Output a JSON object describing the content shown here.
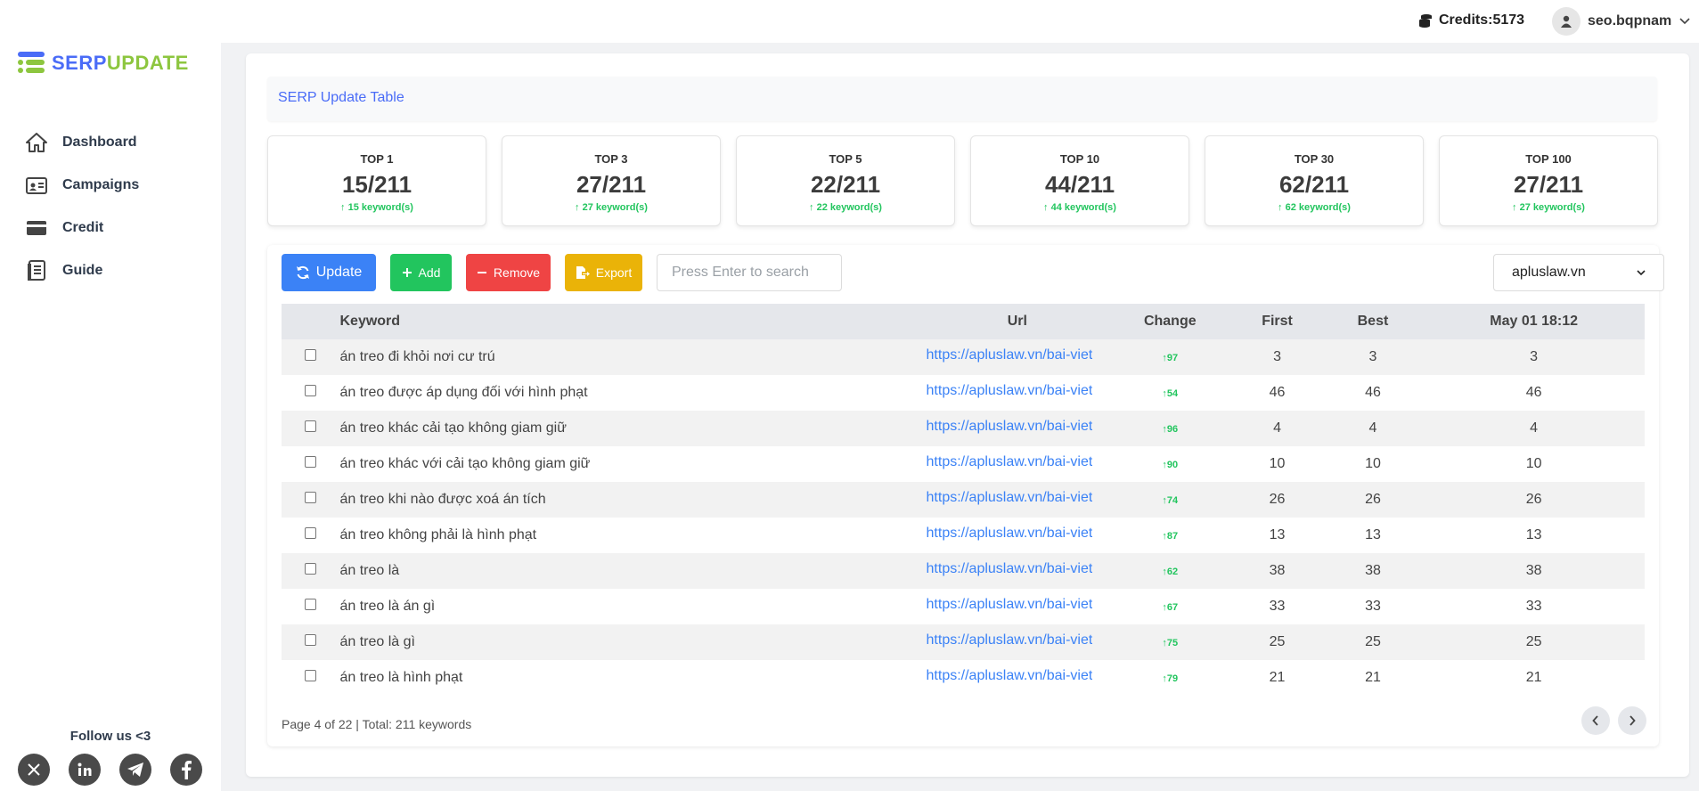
{
  "brand": {
    "part1": "SERP",
    "part2": "UPDATE"
  },
  "sidebar": {
    "items": [
      {
        "label": "Dashboard",
        "icon": "home-icon"
      },
      {
        "label": "Campaigns",
        "icon": "id-card-icon"
      },
      {
        "label": "Credit",
        "icon": "credit-card-icon"
      },
      {
        "label": "Guide",
        "icon": "book-icon"
      }
    ],
    "follow": "Follow us <3",
    "socials": [
      "x-icon",
      "linkedin-icon",
      "telegram-icon",
      "facebook-icon"
    ]
  },
  "topbar": {
    "credits": "Credits:5173",
    "username": "seo.bqpnam"
  },
  "table_title": "SERP Update Table",
  "stats": [
    {
      "title": "TOP 1",
      "value": "15/211",
      "change": "↑ 15 keyword(s)"
    },
    {
      "title": "TOP 3",
      "value": "27/211",
      "change": "↑ 27 keyword(s)"
    },
    {
      "title": "TOP 5",
      "value": "22/211",
      "change": "↑ 22 keyword(s)"
    },
    {
      "title": "TOP 10",
      "value": "44/211",
      "change": "↑ 44 keyword(s)"
    },
    {
      "title": "TOP 30",
      "value": "62/211",
      "change": "↑ 62 keyword(s)"
    },
    {
      "title": "TOP 100",
      "value": "27/211",
      "change": "↑ 27 keyword(s)"
    }
  ],
  "toolbar": {
    "update": "Update",
    "add": "Add",
    "remove": "Remove",
    "export": "Export",
    "search_placeholder": "Press Enter to search",
    "domain": "apluslaw.vn"
  },
  "columns": [
    "Keyword",
    "Url",
    "Change",
    "First",
    "Best",
    "May 01 18:12"
  ],
  "rows": [
    {
      "keyword": "án treo đi khỏi nơi cư trú",
      "url": "https://apluslaw.vn/bai-viet",
      "change": "↑97",
      "first": "3",
      "best": "3",
      "latest": "3"
    },
    {
      "keyword": "án treo được áp dụng đối với hình phạt",
      "url": "https://apluslaw.vn/bai-viet",
      "change": "↑54",
      "first": "46",
      "best": "46",
      "latest": "46"
    },
    {
      "keyword": "án treo khác cải tạo không giam giữ",
      "url": "https://apluslaw.vn/bai-viet",
      "change": "↑96",
      "first": "4",
      "best": "4",
      "latest": "4"
    },
    {
      "keyword": "án treo khác với cải tạo không giam giữ",
      "url": "https://apluslaw.vn/bai-viet",
      "change": "↑90",
      "first": "10",
      "best": "10",
      "latest": "10"
    },
    {
      "keyword": "án treo khi nào được xoá án tích",
      "url": "https://apluslaw.vn/bai-viet",
      "change": "↑74",
      "first": "26",
      "best": "26",
      "latest": "26"
    },
    {
      "keyword": "án treo không phải là hình phạt",
      "url": "https://apluslaw.vn/bai-viet",
      "change": "↑87",
      "first": "13",
      "best": "13",
      "latest": "13"
    },
    {
      "keyword": "án treo là",
      "url": "https://apluslaw.vn/bai-viet",
      "change": "↑62",
      "first": "38",
      "best": "38",
      "latest": "38"
    },
    {
      "keyword": "án treo là án gì",
      "url": "https://apluslaw.vn/bai-viet",
      "change": "↑67",
      "first": "33",
      "best": "33",
      "latest": "33"
    },
    {
      "keyword": "án treo là gì",
      "url": "https://apluslaw.vn/bai-viet",
      "change": "↑75",
      "first": "25",
      "best": "25",
      "latest": "25"
    },
    {
      "keyword": "án treo là hình phạt",
      "url": "https://apluslaw.vn/bai-viet",
      "change": "↑79",
      "first": "21",
      "best": "21",
      "latest": "21"
    }
  ],
  "footer": {
    "info": "Page 4 of 22 | Total: 211 keywords"
  },
  "colors": {
    "brand_blue": "#4a6cf7",
    "brand_green": "#8dc63f",
    "up_green": "#22c55e"
  }
}
